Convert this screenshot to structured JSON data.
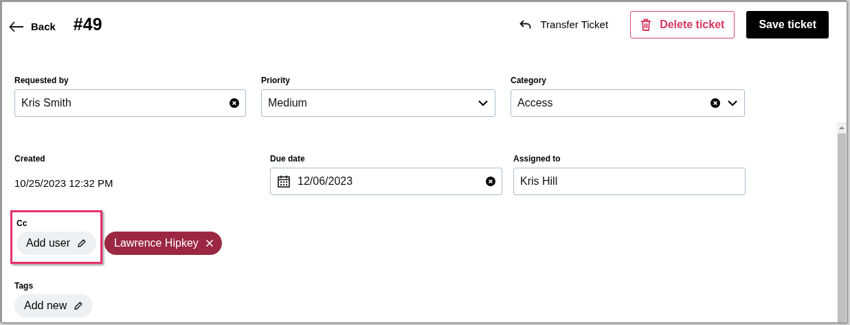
{
  "header": {
    "back": "Back",
    "title": "#49",
    "actions": [
      {
        "kind": "link",
        "label": "Transfer Ticket"
      },
      {
        "kind": "danger",
        "label": "Delete ticket"
      },
      {
        "kind": "primary",
        "label": "Save ticket"
      }
    ]
  },
  "rows": [
    [
      {
        "kind": "input",
        "label": "Requested by",
        "value": "Kris Smith",
        "clearable": true,
        "dropdown": false
      },
      {
        "kind": "input",
        "label": "Priority",
        "value": "Medium",
        "clearable": false,
        "dropdown": true
      },
      {
        "kind": "input",
        "label": "Category",
        "value": "Access",
        "clearable": true,
        "dropdown": true
      }
    ],
    [
      {
        "kind": "static",
        "label": "Created",
        "value": "10/25/2023 12:32 PM"
      },
      {
        "kind": "date",
        "label": "Due date",
        "value": "12/06/2023",
        "clearable": true,
        "dropdown": false
      },
      {
        "kind": "input",
        "label": "Assigned to",
        "value": "Kris Hill",
        "clearable": false,
        "dropdown": false
      }
    ]
  ],
  "cc": {
    "label": "Cc",
    "highlighted": true,
    "add": "Add user",
    "users": [
      {
        "name": "Lawrence Hipkey"
      }
    ]
  },
  "tags": {
    "label": "Tags",
    "add": "Add new"
  }
}
